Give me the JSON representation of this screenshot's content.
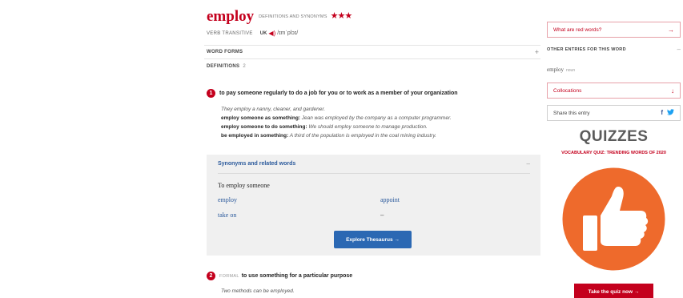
{
  "entry": {
    "headword": "employ",
    "header_sub": "DEFINITIONS AND SYNONYMS",
    "stars": "★★★",
    "part_of_speech": "VERB TRANSITIVE",
    "region": "UK",
    "pronunciation": "/ɪmˈplɔɪ/"
  },
  "sections": {
    "word_forms": "WORD FORMS",
    "definitions": "DEFINITIONS",
    "definitions_count": "2",
    "toggle": "+"
  },
  "sense1": {
    "number": "1",
    "text": "to pay someone regularly to do a job for you or to work as a member of your organization",
    "examples": [
      {
        "bold": "",
        "text": "They employ a nanny, cleaner, and gardener."
      },
      {
        "bold": "employ someone as something:",
        "text": " Jean was employed by the company as a computer programmer."
      },
      {
        "bold": "employ someone to do something:",
        "text": " We should employ someone to manage production."
      },
      {
        "bold": "be employed in something:",
        "text": " A third of the population is employed in the coal mining industry."
      }
    ]
  },
  "synonyms": {
    "title": "Synonyms and related words",
    "toggle": "–",
    "subhead": "To employ someone",
    "items": [
      "employ",
      "appoint",
      "take on",
      "–"
    ],
    "button": "Explore Thesaurus →"
  },
  "sense2": {
    "number": "2",
    "register": "FORMAL",
    "text": "to use something for a particular purpose",
    "example": "Two methods can be employed."
  },
  "sidebar": {
    "red_words": "What are red words?",
    "red_words_arrow": "→",
    "other_entries_title": "OTHER ENTRIES FOR THIS WORD",
    "other_entries_toggle": "–",
    "other_entry_word": "employ",
    "other_entry_pos": "noun",
    "collocations": "Collocations",
    "collocations_arrow": "↓",
    "share": "Share this entry",
    "share_fb": "f",
    "share_tw": "🐦",
    "quizzes_title": "QUIZZES",
    "quiz_name": "VOCABULARY QUIZ: TRENDING WORDS OF 2020",
    "quiz_button": "Take the quiz now →"
  },
  "colors": {
    "brand_red": "#c4001d",
    "link_blue": "#2b5a9c",
    "button_blue": "#2b68b3",
    "quiz_orange": "#ee6a2c"
  },
  "icons": [
    "speaker-icon",
    "plus-icon",
    "minus-icon",
    "arrow-right-icon",
    "arrow-down-icon",
    "facebook-icon",
    "twitter-icon",
    "thumbs-up-icon"
  ]
}
